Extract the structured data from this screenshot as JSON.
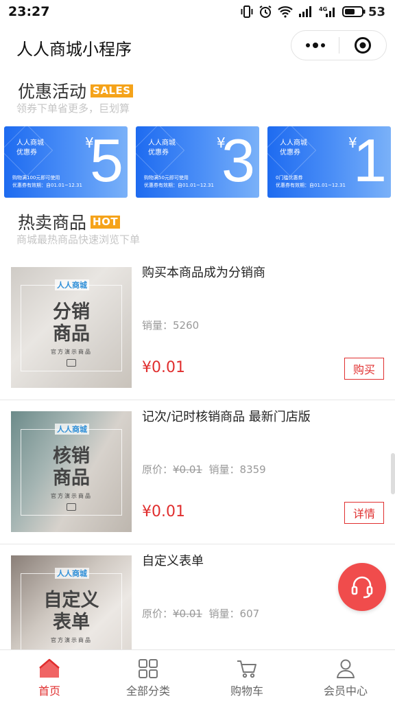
{
  "status_bar": {
    "time": "23:27",
    "battery": "53"
  },
  "header": {
    "title": "人人商城小程序"
  },
  "colors": {
    "accent": "#e02e2e",
    "coupon_blue": "#1e6bf0",
    "sales_badge": "#f5a31a",
    "hot_badge": "#f5a31a",
    "service_button": "#f04c4c"
  },
  "promo": {
    "title": "优惠活动",
    "badge": "SALES",
    "subtitle": "领券下单省更多，巨划算",
    "coupons": [
      {
        "title": "人人商城\n优惠券",
        "currency": "¥",
        "amount": "5",
        "condition": "购物满100元即可使用",
        "validity": "优惠券有效期：自01.01~12.31"
      },
      {
        "title": "人人商城\n优惠券",
        "currency": "¥",
        "amount": "3",
        "condition": "购物满50元即可使用",
        "validity": "优惠券有效期：自01.01~12.31"
      },
      {
        "title": "人人商城\n优惠券",
        "currency": "¥",
        "amount": "1",
        "condition": "0门槛优惠券",
        "validity": "优惠券有效期：自01.01~12.31"
      }
    ]
  },
  "hot": {
    "title": "热卖商品",
    "badge": "HOT",
    "subtitle": "商城最热商品快速浏览下单"
  },
  "products": [
    {
      "thumb_brand": "人人商城",
      "thumb_line1": "分销",
      "thumb_line2": "商品",
      "thumb_caption": "官方演示商品",
      "name": "购买本商品成为分销商",
      "sales_label": "销量：",
      "sales": "5260",
      "price": "¥0.01",
      "button": "购买"
    },
    {
      "thumb_brand": "人人商城",
      "thumb_line1": "核销",
      "thumb_line2": "商品",
      "thumb_caption": "官方演示商品",
      "name": "记次/记时核销商品 最新门店版",
      "original_label": "原价：",
      "original_price": "¥0.01",
      "sales_label": "销量：",
      "sales": "8359",
      "price": "¥0.01",
      "button": "详情"
    },
    {
      "thumb_brand": "人人商城",
      "thumb_line1": "自定义",
      "thumb_line2": "表单",
      "thumb_caption": "官方演示商品",
      "name": "自定义表单",
      "original_label": "原价：",
      "original_price": "¥0.01",
      "sales_label": "销量：",
      "sales": "607"
    }
  ],
  "tabbar": [
    {
      "label": "首页",
      "icon": "home-icon",
      "active": true
    },
    {
      "label": "全部分类",
      "icon": "grid-icon",
      "active": false
    },
    {
      "label": "购物车",
      "icon": "cart-icon",
      "active": false
    },
    {
      "label": "会员中心",
      "icon": "user-icon",
      "active": false
    }
  ]
}
